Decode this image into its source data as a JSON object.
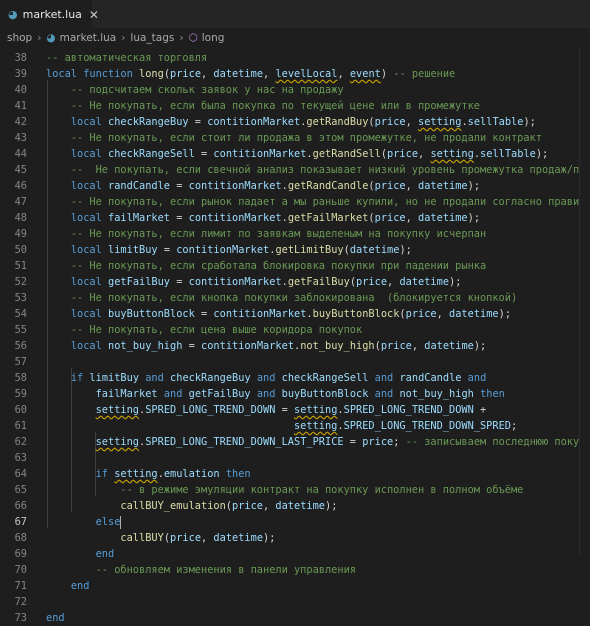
{
  "tab": {
    "name": "market.lua",
    "icon": "lua-file-icon"
  },
  "breadcrumb": [
    "shop",
    "market.lua",
    "lua_tags",
    "long"
  ],
  "lines": [
    {
      "n": "38",
      "t": [
        [
          "cm",
          "-- автоматическая торговля"
        ]
      ]
    },
    {
      "n": "39",
      "t": [
        [
          "kw",
          "local function "
        ],
        [
          "fn",
          "long"
        ],
        [
          "p",
          "("
        ],
        [
          "var",
          "price"
        ],
        [
          "p",
          ", "
        ],
        [
          "var",
          "datetime"
        ],
        [
          "p",
          ", "
        ],
        [
          "varsq",
          "levelLocal"
        ],
        [
          "p",
          ", "
        ],
        [
          "varsq",
          "event"
        ],
        [
          "p",
          ") "
        ],
        [
          "cm",
          "-- решение"
        ]
      ]
    },
    {
      "n": "40",
      "t": [
        [
          "p",
          "    "
        ],
        [
          "cm",
          "-- подсчитаем скольк заявок у нас на продажу"
        ]
      ]
    },
    {
      "n": "41",
      "t": [
        [
          "p",
          "    "
        ],
        [
          "cm",
          "-- Не покупать, если была покупка по текущей цене или в промежутке"
        ]
      ]
    },
    {
      "n": "42",
      "t": [
        [
          "p",
          "    "
        ],
        [
          "kw",
          "local "
        ],
        [
          "var",
          "checkRangeBuy"
        ],
        [
          "p",
          " = "
        ],
        [
          "var",
          "contitionMarket"
        ],
        [
          "p",
          "."
        ],
        [
          "fn",
          "getRandBuy"
        ],
        [
          "p",
          "("
        ],
        [
          "var",
          "price"
        ],
        [
          "p",
          ", "
        ],
        [
          "varsq",
          "setting"
        ],
        [
          "p",
          "."
        ],
        [
          "var",
          "sellTable"
        ],
        [
          "p",
          ");"
        ]
      ]
    },
    {
      "n": "43",
      "t": [
        [
          "p",
          "    "
        ],
        [
          "cm",
          "-- Не покупать, если стоит ли продажа в этом промежутке, не продали контракт"
        ]
      ]
    },
    {
      "n": "44",
      "t": [
        [
          "p",
          "    "
        ],
        [
          "kw",
          "local "
        ],
        [
          "var",
          "checkRangeSell"
        ],
        [
          "p",
          " = "
        ],
        [
          "var",
          "contitionMarket"
        ],
        [
          "p",
          "."
        ],
        [
          "fn",
          "getRandSell"
        ],
        [
          "p",
          "("
        ],
        [
          "var",
          "price"
        ],
        [
          "p",
          ", "
        ],
        [
          "varsq",
          "setting"
        ],
        [
          "p",
          "."
        ],
        [
          "var",
          "sellTable"
        ],
        [
          "p",
          ");"
        ]
      ]
    },
    {
      "n": "45",
      "t": [
        [
          "p",
          "    "
        ],
        [
          "cm",
          "--  Не покупать, если свечной анализ показывает низкий уровень промежутка продаж/покупок"
        ]
      ]
    },
    {
      "n": "46",
      "t": [
        [
          "p",
          "    "
        ],
        [
          "kw",
          "local "
        ],
        [
          "var",
          "randCandle"
        ],
        [
          "p",
          " = "
        ],
        [
          "var",
          "contitionMarket"
        ],
        [
          "p",
          "."
        ],
        [
          "fn",
          "getRandCandle"
        ],
        [
          "p",
          "("
        ],
        [
          "var",
          "price"
        ],
        [
          "p",
          ", "
        ],
        [
          "var",
          "datetime"
        ],
        [
          "p",
          ");"
        ]
      ]
    },
    {
      "n": "47",
      "t": [
        [
          "p",
          "    "
        ],
        [
          "cm",
          "-- Не покупать, если рынок падает а мы раньше купили, но не продали согласно правилам"
        ]
      ]
    },
    {
      "n": "48",
      "t": [
        [
          "p",
          "    "
        ],
        [
          "kw",
          "local "
        ],
        [
          "var",
          "failMarket"
        ],
        [
          "p",
          " = "
        ],
        [
          "var",
          "contitionMarket"
        ],
        [
          "p",
          "."
        ],
        [
          "fn",
          "getFailMarket"
        ],
        [
          "p",
          "("
        ],
        [
          "var",
          "price"
        ],
        [
          "p",
          ", "
        ],
        [
          "var",
          "datetime"
        ],
        [
          "p",
          ");"
        ]
      ]
    },
    {
      "n": "49",
      "t": [
        [
          "p",
          "    "
        ],
        [
          "cm",
          "-- Не покупать, если лимит по заявкам выделеным на покупку исчерпан"
        ]
      ]
    },
    {
      "n": "50",
      "t": [
        [
          "p",
          "    "
        ],
        [
          "kw",
          "local "
        ],
        [
          "var",
          "limitBuy"
        ],
        [
          "p",
          " = "
        ],
        [
          "var",
          "contitionMarket"
        ],
        [
          "p",
          "."
        ],
        [
          "fn",
          "getLimitBuy"
        ],
        [
          "p",
          "("
        ],
        [
          "var",
          "datetime"
        ],
        [
          "p",
          ");"
        ]
      ]
    },
    {
      "n": "51",
      "t": [
        [
          "p",
          "    "
        ],
        [
          "cm",
          "-- Не покупать, если сработала блокировка покупки при падении рынка"
        ]
      ]
    },
    {
      "n": "52",
      "t": [
        [
          "p",
          "    "
        ],
        [
          "kw",
          "local "
        ],
        [
          "var",
          "getFailBuy"
        ],
        [
          "p",
          " = "
        ],
        [
          "var",
          "contitionMarket"
        ],
        [
          "p",
          "."
        ],
        [
          "fn",
          "getFailBuy"
        ],
        [
          "p",
          "("
        ],
        [
          "var",
          "price"
        ],
        [
          "p",
          ", "
        ],
        [
          "var",
          "datetime"
        ],
        [
          "p",
          ");"
        ]
      ]
    },
    {
      "n": "53",
      "t": [
        [
          "p",
          "    "
        ],
        [
          "cm",
          "-- Не покупать, если кнопка покупки заблокирована  (блокируется кнопкой)"
        ]
      ]
    },
    {
      "n": "54",
      "t": [
        [
          "p",
          "    "
        ],
        [
          "kw",
          "local "
        ],
        [
          "var",
          "buyButtonBlock"
        ],
        [
          "p",
          " = "
        ],
        [
          "var",
          "contitionMarket"
        ],
        [
          "p",
          "."
        ],
        [
          "fn",
          "buyButtonBlock"
        ],
        [
          "p",
          "("
        ],
        [
          "var",
          "price"
        ],
        [
          "p",
          ", "
        ],
        [
          "var",
          "datetime"
        ],
        [
          "p",
          ");"
        ]
      ]
    },
    {
      "n": "55",
      "t": [
        [
          "p",
          "    "
        ],
        [
          "cm",
          "-- Не покупать, если цена выше коридора покупок"
        ]
      ]
    },
    {
      "n": "56",
      "t": [
        [
          "p",
          "    "
        ],
        [
          "kw",
          "local "
        ],
        [
          "var",
          "not_buy_high"
        ],
        [
          "p",
          " = "
        ],
        [
          "var",
          "contitionMarket"
        ],
        [
          "p",
          "."
        ],
        [
          "fn",
          "not_buy_high"
        ],
        [
          "p",
          "("
        ],
        [
          "var",
          "price"
        ],
        [
          "p",
          ", "
        ],
        [
          "var",
          "datetime"
        ],
        [
          "p",
          ");"
        ]
      ]
    },
    {
      "n": "57",
      "t": []
    },
    {
      "n": "58",
      "t": [
        [
          "p",
          "    "
        ],
        [
          "kw",
          "if "
        ],
        [
          "var",
          "limitBuy"
        ],
        [
          "p",
          " "
        ],
        [
          "kw",
          "and "
        ],
        [
          "var",
          "checkRangeBuy"
        ],
        [
          "p",
          " "
        ],
        [
          "kw",
          "and "
        ],
        [
          "var",
          "checkRangeSell"
        ],
        [
          "p",
          " "
        ],
        [
          "kw",
          "and "
        ],
        [
          "var",
          "randCandle"
        ],
        [
          "p",
          " "
        ],
        [
          "kw",
          "and"
        ]
      ]
    },
    {
      "n": "59",
      "t": [
        [
          "p",
          "        "
        ],
        [
          "var",
          "failMarket"
        ],
        [
          "p",
          " "
        ],
        [
          "kw",
          "and "
        ],
        [
          "var",
          "getFailBuy"
        ],
        [
          "p",
          " "
        ],
        [
          "kw",
          "and "
        ],
        [
          "var",
          "buyButtonBlock"
        ],
        [
          "p",
          " "
        ],
        [
          "kw",
          "and "
        ],
        [
          "var",
          "not_buy_high"
        ],
        [
          "p",
          " "
        ],
        [
          "kw",
          "then"
        ]
      ]
    },
    {
      "n": "60",
      "t": [
        [
          "p",
          "        "
        ],
        [
          "varsq",
          "setting"
        ],
        [
          "p",
          "."
        ],
        [
          "var",
          "SPRED_LONG_TREND_DOWN"
        ],
        [
          "p",
          " = "
        ],
        [
          "varsq",
          "setting"
        ],
        [
          "p",
          "."
        ],
        [
          "var",
          "SPRED_LONG_TREND_DOWN"
        ],
        [
          "p",
          " +"
        ]
      ]
    },
    {
      "n": "61",
      "t": [
        [
          "p",
          "                                        "
        ],
        [
          "varsq",
          "setting"
        ],
        [
          "p",
          "."
        ],
        [
          "var",
          "SPRED_LONG_TREND_DOWN_SPRED"
        ],
        [
          "p",
          ";"
        ]
      ]
    },
    {
      "n": "62",
      "t": [
        [
          "p",
          "        "
        ],
        [
          "varsq",
          "setting"
        ],
        [
          "p",
          "."
        ],
        [
          "var",
          "SPRED_LONG_TREND_DOWN_LAST_PRICE"
        ],
        [
          "p",
          " = "
        ],
        [
          "var",
          "price"
        ],
        [
          "p",
          "; "
        ],
        [
          "cm",
          "-- записываем последнюю покупку"
        ]
      ]
    },
    {
      "n": "63",
      "t": []
    },
    {
      "n": "64",
      "t": [
        [
          "p",
          "        "
        ],
        [
          "kw",
          "if "
        ],
        [
          "varsq",
          "setting"
        ],
        [
          "p",
          "."
        ],
        [
          "var",
          "emulation"
        ],
        [
          "p",
          " "
        ],
        [
          "kw",
          "then"
        ]
      ]
    },
    {
      "n": "65",
      "t": [
        [
          "p",
          "            "
        ],
        [
          "cm",
          "-- в режиме эмуляции контракт на покупку исполнен в полном объёме"
        ]
      ]
    },
    {
      "n": "66",
      "t": [
        [
          "p",
          "            "
        ],
        [
          "fn",
          "callBUY_emulation"
        ],
        [
          "p",
          "("
        ],
        [
          "var",
          "price"
        ],
        [
          "p",
          ", "
        ],
        [
          "var",
          "datetime"
        ],
        [
          "p",
          ");"
        ]
      ]
    },
    {
      "n": "67",
      "t": [
        [
          "p",
          "        "
        ],
        [
          "kw",
          "else"
        ],
        [
          "cursor",
          ""
        ]
      ]
    },
    {
      "n": "68",
      "t": [
        [
          "p",
          "            "
        ],
        [
          "fn",
          "callBUY"
        ],
        [
          "p",
          "("
        ],
        [
          "var",
          "price"
        ],
        [
          "p",
          ", "
        ],
        [
          "var",
          "datetime"
        ],
        [
          "p",
          ");"
        ]
      ]
    },
    {
      "n": "69",
      "t": [
        [
          "p",
          "        "
        ],
        [
          "kw",
          "end"
        ]
      ]
    },
    {
      "n": "70",
      "t": [
        [
          "p",
          "        "
        ],
        [
          "cm",
          "-- обновляем изменения в панели управления"
        ]
      ]
    },
    {
      "n": "71",
      "t": [
        [
          "p",
          "    "
        ],
        [
          "kw",
          "end"
        ]
      ]
    },
    {
      "n": "72",
      "t": []
    },
    {
      "n": "73",
      "t": [
        [
          "kw",
          "end"
        ]
      ]
    }
  ]
}
